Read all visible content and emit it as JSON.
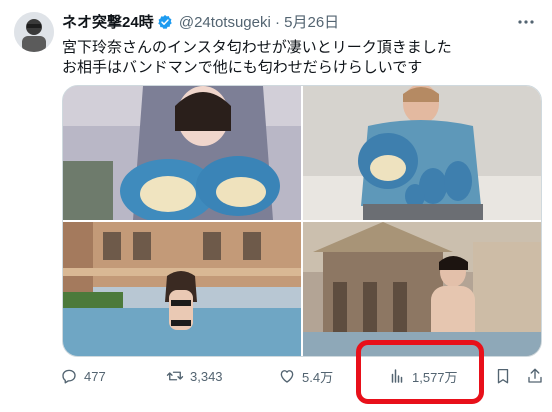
{
  "tweet": {
    "author": {
      "display_name": "ネオ突撃24時",
      "handle": "@24totsugeki",
      "separator": "·",
      "date": "5月26日",
      "avatar_icon": "avatar-photo"
    },
    "text_line1": "宮下玲奈さんのインスタ匂わせが凄いとリーク頂きました",
    "text_line2": "お相手はバンドマンで他にも匂わせだらけらしいです",
    "more_icon": "more-options-icon",
    "verified_icon": "verified-badge-icon",
    "verified_color": "#1d9bf0"
  },
  "media": {
    "photos": [
      {
        "icon": "photo-woman-in-hoodie-with-plush"
      },
      {
        "icon": "photo-man-with-plush-toys"
      },
      {
        "icon": "photo-woman-at-pool"
      },
      {
        "icon": "photo-man-at-pool"
      }
    ]
  },
  "actions": {
    "reply_count": "477",
    "retweet_count": "3,343",
    "like_count": "5.4万",
    "view_count": "1,577万"
  },
  "annotation": {
    "highlight_color": "#e8101a"
  }
}
